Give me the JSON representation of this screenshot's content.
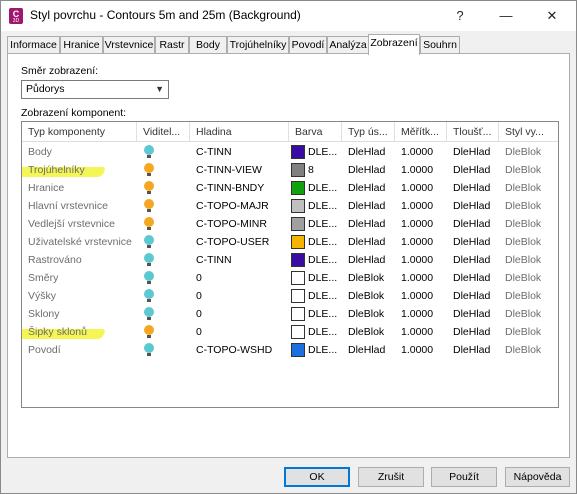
{
  "window": {
    "title": "Styl povrchu - Contours 5m and 25m (Background)",
    "icon_letter": "C",
    "icon_sub": "3D",
    "controls": [
      "?",
      "—",
      "☐",
      "✕"
    ]
  },
  "tabs": [
    {
      "label": "Informace",
      "active": false
    },
    {
      "label": "Hranice",
      "active": false
    },
    {
      "label": "Vrstevnice",
      "active": false
    },
    {
      "label": "Rastr",
      "active": false
    },
    {
      "label": "Body",
      "active": false
    },
    {
      "label": "Trojúhelníky",
      "active": false
    },
    {
      "label": "Povodí",
      "active": false
    },
    {
      "label": "Analýza",
      "active": false
    },
    {
      "label": "Zobrazení",
      "active": true
    },
    {
      "label": "Souhrn",
      "active": false
    }
  ],
  "view_direction": {
    "label": "Směr zobrazení:",
    "value": "Půdorys"
  },
  "components": {
    "label": "Zobrazení komponent:",
    "headers": [
      "Typ komponenty",
      "Viditel...",
      "Hladina",
      "Barva",
      "Typ ús...",
      "Měřítk...",
      "Tloušť...",
      "Styl vy..."
    ],
    "rows": [
      {
        "name": "Body",
        "visible": false,
        "layer": "C-TINN",
        "color": "#3a0ca3",
        "color_text": "DLE...",
        "linetype": "DleHlad",
        "scale": "1.0000",
        "weight": "DleHlad",
        "plotstyle": "DleBlok",
        "highlight": false
      },
      {
        "name": "Trojúhelníky",
        "visible": true,
        "layer": "C-TINN-VIEW",
        "color": "#808080",
        "color_text": "8",
        "linetype": "DleHlad",
        "scale": "1.0000",
        "weight": "DleHlad",
        "plotstyle": "DleBlok",
        "highlight": true
      },
      {
        "name": "Hranice",
        "visible": true,
        "layer": "C-TINN-BNDY",
        "color": "#10a010",
        "color_text": "DLE...",
        "linetype": "DleHlad",
        "scale": "1.0000",
        "weight": "DleHlad",
        "plotstyle": "DleBlok",
        "highlight": false
      },
      {
        "name": "Hlavní vrstevnice",
        "visible": true,
        "layer": "C-TOPO-MAJR",
        "color": "#c0c0c0",
        "color_text": "DLE...",
        "linetype": "DleHlad",
        "scale": "1.0000",
        "weight": "DleHlad",
        "plotstyle": "DleBlok",
        "highlight": false
      },
      {
        "name": "Vedlejší vrstevnice",
        "visible": true,
        "layer": "C-TOPO-MINR",
        "color": "#a0a0a0",
        "color_text": "DLE...",
        "linetype": "DleHlad",
        "scale": "1.0000",
        "weight": "DleHlad",
        "plotstyle": "DleBlok",
        "highlight": false
      },
      {
        "name": "Uživatelské vrstevnice",
        "visible": false,
        "layer": "C-TOPO-USER",
        "color": "#f5b400",
        "color_text": "DLE...",
        "linetype": "DleHlad",
        "scale": "1.0000",
        "weight": "DleHlad",
        "plotstyle": "DleBlok",
        "highlight": false
      },
      {
        "name": "Rastrováno",
        "visible": false,
        "layer": "C-TINN",
        "color": "#3a0ca3",
        "color_text": "DLE...",
        "linetype": "DleHlad",
        "scale": "1.0000",
        "weight": "DleHlad",
        "plotstyle": "DleBlok",
        "highlight": false
      },
      {
        "name": "Směry",
        "visible": false,
        "layer": "0",
        "color": "#ffffff",
        "color_text": "DLE...",
        "linetype": "DleBlok",
        "scale": "1.0000",
        "weight": "DleHlad",
        "plotstyle": "DleBlok",
        "highlight": false
      },
      {
        "name": "Výšky",
        "visible": false,
        "layer": "0",
        "color": "#ffffff",
        "color_text": "DLE...",
        "linetype": "DleBlok",
        "scale": "1.0000",
        "weight": "DleHlad",
        "plotstyle": "DleBlok",
        "highlight": false
      },
      {
        "name": "Sklony",
        "visible": false,
        "layer": "0",
        "color": "#ffffff",
        "color_text": "DLE...",
        "linetype": "DleBlok",
        "scale": "1.0000",
        "weight": "DleHlad",
        "plotstyle": "DleBlok",
        "highlight": false
      },
      {
        "name": "Šipky sklonů",
        "visible": true,
        "layer": "0",
        "color": "#ffffff",
        "color_text": "DLE...",
        "linetype": "DleBlok",
        "scale": "1.0000",
        "weight": "DleHlad",
        "plotstyle": "DleBlok",
        "highlight": true
      },
      {
        "name": "Povodí",
        "visible": false,
        "layer": "C-TOPO-WSHD",
        "color": "#1c6fe0",
        "color_text": "DLE...",
        "linetype": "DleHlad",
        "scale": "1.0000",
        "weight": "DleHlad",
        "plotstyle": "DleBlok",
        "highlight": false
      }
    ]
  },
  "bulb_colors": {
    "on": "#f5a623",
    "off": "#5cc8d0"
  },
  "buttons": {
    "ok": "OK",
    "cancel": "Zrušit",
    "apply": "Použít",
    "help": "Nápověda"
  }
}
